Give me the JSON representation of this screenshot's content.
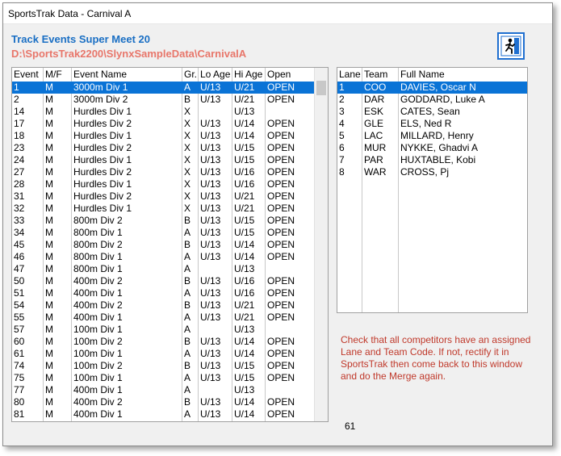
{
  "window": {
    "title": "SportsTrak Data - Carnival A"
  },
  "header": {
    "heading": "Track Events  Super Meet 20",
    "path": "D:\\SportsTrak2200\\SlynxSampleData\\CarnivalA"
  },
  "exit_button": {
    "icon": "running-man-exit-icon"
  },
  "events": {
    "columns": [
      "Event",
      "M/F",
      "Event Name",
      "Gr.",
      "Lo Age",
      "Hi Age",
      "Open"
    ],
    "selected_index": 0,
    "rows": [
      [
        "1",
        "M",
        "3000m Div 1",
        "A",
        "U/13",
        "U/21",
        "OPEN"
      ],
      [
        "2",
        "M",
        "3000m Div 2",
        "B",
        "U/13",
        "U/21",
        "OPEN"
      ],
      [
        "14",
        "M",
        "Hurdles Div 1",
        "X",
        "",
        "U/13",
        ""
      ],
      [
        "17",
        "M",
        "Hurdles Div 2",
        "X",
        "U/13",
        "U/14",
        "OPEN"
      ],
      [
        "18",
        "M",
        "Hurdles Div 1",
        "X",
        "U/13",
        "U/14",
        "OPEN"
      ],
      [
        "23",
        "M",
        "Hurdles Div 2",
        "X",
        "U/13",
        "U/15",
        "OPEN"
      ],
      [
        "24",
        "M",
        "Hurdles Div 1",
        "X",
        "U/13",
        "U/15",
        "OPEN"
      ],
      [
        "27",
        "M",
        "Hurdles Div 2",
        "X",
        "U/13",
        "U/16",
        "OPEN"
      ],
      [
        "28",
        "M",
        "Hurdles Div 1",
        "X",
        "U/13",
        "U/16",
        "OPEN"
      ],
      [
        "31",
        "M",
        "Hurdles Div 2",
        "X",
        "U/13",
        "U/21",
        "OPEN"
      ],
      [
        "32",
        "M",
        "Hurdles Div 1",
        "X",
        "U/13",
        "U/21",
        "OPEN"
      ],
      [
        "33",
        "M",
        "800m Div 2",
        "B",
        "U/13",
        "U/15",
        "OPEN"
      ],
      [
        "34",
        "M",
        "800m Div 1",
        "A",
        "U/13",
        "U/15",
        "OPEN"
      ],
      [
        "45",
        "M",
        "800m Div 2",
        "B",
        "U/13",
        "U/14",
        "OPEN"
      ],
      [
        "46",
        "M",
        "800m Div 1",
        "A",
        "U/13",
        "U/14",
        "OPEN"
      ],
      [
        "47",
        "M",
        "800m Div 1",
        "A",
        "",
        "U/13",
        ""
      ],
      [
        "50",
        "M",
        "400m Div 2",
        "B",
        "U/13",
        "U/16",
        "OPEN"
      ],
      [
        "51",
        "M",
        "400m Div 1",
        "A",
        "U/13",
        "U/16",
        "OPEN"
      ],
      [
        "54",
        "M",
        "400m Div 2",
        "B",
        "U/13",
        "U/21",
        "OPEN"
      ],
      [
        "55",
        "M",
        "400m Div 1",
        "A",
        "U/13",
        "U/21",
        "OPEN"
      ],
      [
        "57",
        "M",
        "100m Div 1",
        "A",
        "",
        "U/13",
        ""
      ],
      [
        "60",
        "M",
        "100m Div 2",
        "B",
        "U/13",
        "U/14",
        "OPEN"
      ],
      [
        "61",
        "M",
        "100m Div 1",
        "A",
        "U/13",
        "U/14",
        "OPEN"
      ],
      [
        "74",
        "M",
        "100m Div 2",
        "B",
        "U/13",
        "U/15",
        "OPEN"
      ],
      [
        "75",
        "M",
        "100m Div 1",
        "A",
        "U/13",
        "U/15",
        "OPEN"
      ],
      [
        "77",
        "M",
        "400m Div 1",
        "A",
        "",
        "U/13",
        ""
      ],
      [
        "80",
        "M",
        "400m Div 2",
        "B",
        "U/13",
        "U/14",
        "OPEN"
      ],
      [
        "81",
        "M",
        "400m Div 1",
        "A",
        "U/13",
        "U/14",
        "OPEN"
      ]
    ]
  },
  "lanes": {
    "columns": [
      "Lane",
      "Team",
      "Full Name"
    ],
    "selected_index": 0,
    "rows": [
      [
        "1",
        "COO",
        "DAVIES, Oscar N"
      ],
      [
        "2",
        "DAR",
        "GODDARD, Luke A"
      ],
      [
        "3",
        "ESK",
        "CATES, Sean"
      ],
      [
        "4",
        "GLE",
        "ELS, Ned R"
      ],
      [
        "5",
        "LAC",
        "MILLARD, Henry"
      ],
      [
        "6",
        "MUR",
        "NYKKE, Ghadvi A"
      ],
      [
        "7",
        "PAR",
        "HUXTABLE, Kobi"
      ],
      [
        "8",
        "WAR",
        "CROSS, Pj"
      ]
    ]
  },
  "note": "Check that all competitors have an assigned Lane and Team Code.  If not, rectify it in SportsTrak then come back to this window and do the Merge again.",
  "count": "61",
  "colors": {
    "selection": "#0a73d6",
    "heading": "#1a6fc4",
    "path": "#e8766a",
    "note": "#c0392b"
  }
}
